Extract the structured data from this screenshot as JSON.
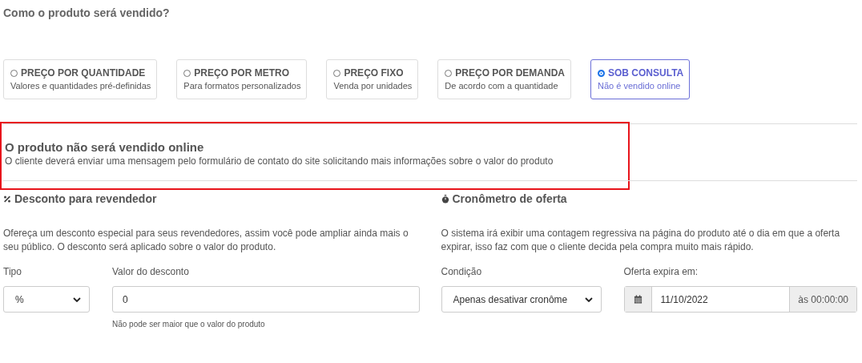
{
  "question": "Como o produto será vendido?",
  "options": [
    {
      "label": "PREÇO POR QUANTIDADE",
      "description": "Valores e quantidades pré-definidas",
      "selected": false
    },
    {
      "label": "PREÇO POR METRO",
      "description": "Para formatos personalizados",
      "selected": false
    },
    {
      "label": "PREÇO FIXO",
      "description": "Venda por unidades",
      "selected": false
    },
    {
      "label": "PREÇO POR DEMANDA",
      "description": "De acordo com a quantidade",
      "selected": false
    },
    {
      "label": "SOB CONSULTA",
      "description": "Não é vendido online",
      "selected": true
    }
  ],
  "notice": {
    "title": "O produto não será vendido online",
    "text": "O cliente deverá enviar uma mensagem pelo formulário de contato do site solicitando mais informações sobre o valor do produto",
    "highlighted": true
  },
  "discount": {
    "title": "Desconto para revendedor",
    "text": "Ofereça um desconto especial para seus revendedores, assim você pode ampliar ainda mais o seu público. O desconto será aplicado sobre o valor do produto.",
    "type_label": "Tipo",
    "type_value": "%",
    "value_label": "Valor do desconto",
    "value": "0",
    "hint": "Não pode ser maior que o valor do produto"
  },
  "timer": {
    "title": "Cronômetro de oferta",
    "text": "O sistema irá exibir uma contagem regressiva na página do produto até o dia em que a oferta expirar, isso faz com que o cliente decida pela compra muito mais rápido.",
    "condition_label": "Condição",
    "condition_value": "Apenas desativar cronôme",
    "expires_label": "Oferta expira em:",
    "date": "11/10/2022",
    "time": "às 00:00:00"
  }
}
